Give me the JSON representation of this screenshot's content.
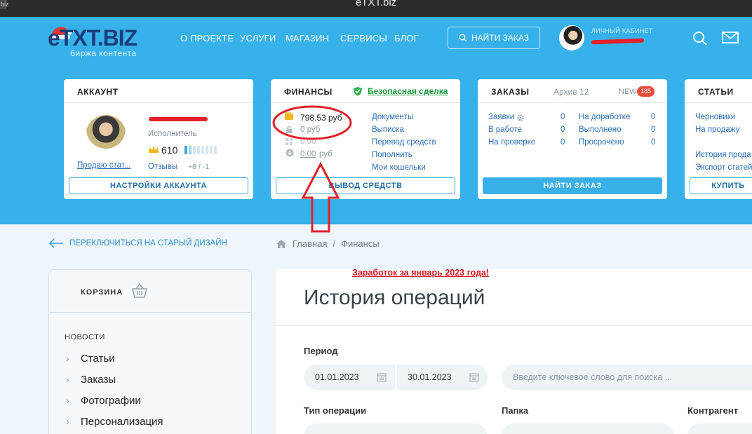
{
  "window": {
    "title": "eTXT.biz",
    "corner_label": "biz"
  },
  "logo": {
    "text": "eTXT.BIZ",
    "tagline": "биржа контента"
  },
  "nav": [
    "О ПРОЕКТЕ",
    "УСЛУГИ",
    "МАГАЗИН",
    "СЕРВИСЫ",
    "БЛОГ"
  ],
  "header": {
    "find_order": "НАЙТИ ЗАКАЗ",
    "cabinet": "ЛИЧНЫЙ КАБИНЕТ"
  },
  "account": {
    "title": "АККАУНТ",
    "role": "Исполнитель",
    "rating": "610",
    "selling": "Продаю стат...",
    "reviews_label": "Отзывы",
    "reviews_value": "+8 / -1",
    "settings_btn": "НАСТРОЙКИ АККАУНТА"
  },
  "finance": {
    "title": "ФИНАНСЫ",
    "safe_deal": "Безопасная сделка",
    "balance": "798.53 руб",
    "blocked": "0 руб",
    "bonus": "0.00",
    "pending_value": "0.00",
    "pending_unit": "руб",
    "links": [
      "Документы",
      "Выписка",
      "Перевод средств",
      "Пополнить",
      "Мои кошельки"
    ],
    "withdraw_btn": "ВЫВОД СРЕДСТВ"
  },
  "orders": {
    "title": "ЗАКАЗЫ",
    "archive": "Архив 12",
    "new_label": "NEW",
    "new_count": "185",
    "left": [
      {
        "label": "Заявки",
        "value": "0"
      },
      {
        "label": "В работе",
        "value": "0"
      },
      {
        "label": "На проверке",
        "value": "0"
      }
    ],
    "right": [
      {
        "label": "На доработке",
        "value": "0"
      },
      {
        "label": "Выполнено",
        "value": "0"
      },
      {
        "label": "Просрочено",
        "value": "0"
      }
    ],
    "find_btn": "НАЙТИ ЗАКАЗ"
  },
  "articles": {
    "title": "СТАТЬИ",
    "links": [
      "Черновики",
      "На продажу",
      "История прода",
      "Экспорт статей"
    ],
    "buy_btn": "КУПИТЬ"
  },
  "switch_design": "ПЕРЕКЛЮЧИТЬСЯ НА СТАРЫЙ ДИЗАЙН",
  "breadcrumb": {
    "home": "Главная",
    "sep": "/",
    "current": "Финансы"
  },
  "annotation": "Заработок за январь 2023 года!",
  "sidebar": {
    "cart": "КОРЗИНА",
    "section": "НОВОСТИ",
    "items": [
      "Статьи",
      "Заказы",
      "Фотографии",
      "Персонализация"
    ]
  },
  "history": {
    "title": "История операций",
    "period_label": "Период",
    "date_from": "01.01.2023",
    "date_to": "30.01.2023",
    "search_placeholder": "Введите ключевое слово для поиска ...",
    "type_label": "Тип операции",
    "folder_label": "Папка",
    "contractor_label": "Контрагент"
  },
  "colors": {
    "hero": "#36b1ea",
    "accent_red": "#e4202a",
    "link": "#2a6db5",
    "green": "#1a9c3a"
  }
}
